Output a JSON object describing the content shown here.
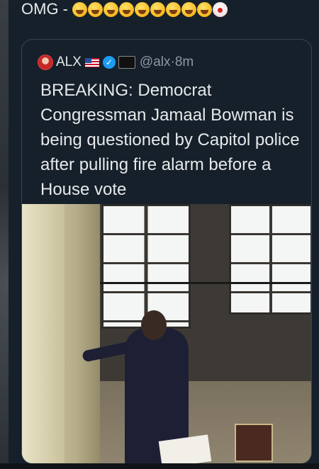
{
  "post": {
    "text": "OMG -",
    "emojis": [
      "rolling-laughing-emoji",
      "rolling-laughing-emoji",
      "rolling-laughing-emoji",
      "rolling-laughing-emoji",
      "rolling-laughing-emoji",
      "rolling-laughing-emoji",
      "rolling-laughing-emoji",
      "rolling-laughing-emoji",
      "rolling-laughing-emoji",
      "clown-emoji"
    ]
  },
  "quoted_tweet": {
    "author_name": "ALX",
    "handle": "@alx",
    "separator": "·",
    "time": "8m",
    "verified_label": "✓",
    "body": "BREAKING: Democrat Congressman Jamaal Bowman is being questioned by Capitol police after pulling fire alarm before a House vote",
    "icons": [
      "avatar",
      "us-flag-icon",
      "verified-badge-icon",
      "affiliate-badge-icon"
    ]
  },
  "colors": {
    "background": "#15202b",
    "text": "#e7e9ea",
    "muted": "#8b98a5",
    "verified": "#1d9bf0",
    "border": "#38444d"
  }
}
